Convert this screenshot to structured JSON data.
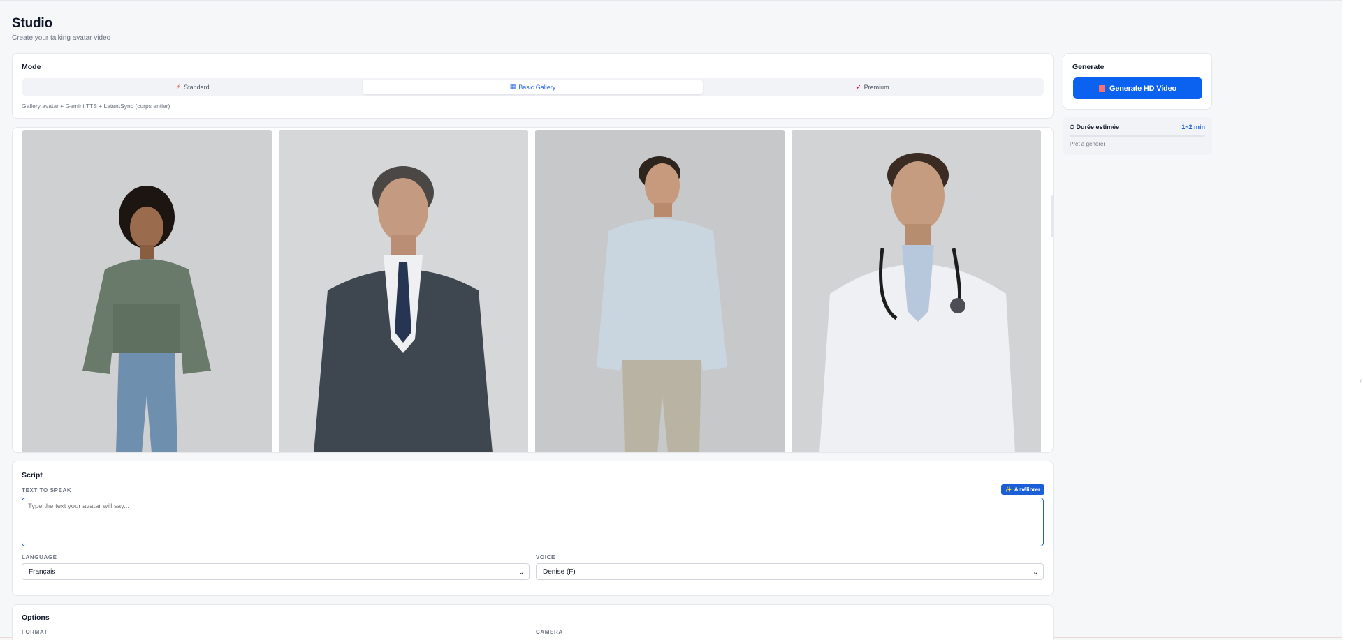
{
  "header": {
    "title": "Studio",
    "subtitle": "Create your talking avatar video"
  },
  "mode": {
    "title": "Mode",
    "options": [
      {
        "label": "Standard",
        "icon": "lightning-icon"
      },
      {
        "label": "Basic Gallery",
        "icon": "gallery-icon"
      },
      {
        "label": "Premium",
        "icon": "crown-icon"
      }
    ],
    "selected": "Basic Gallery",
    "description": "Gallery avatar + Gemini TTS + LatentSync (corps entier)"
  },
  "gallery": {
    "avatars": [
      {
        "name": "woman-green-hoodie"
      },
      {
        "name": "man-business-suit"
      },
      {
        "name": "man-light-shirt"
      },
      {
        "name": "man-doctor-coat"
      }
    ]
  },
  "script": {
    "title": "Script",
    "tts_label": "TEXT TO SPEAK",
    "improve_label": "Améliorer",
    "textarea_placeholder": "Type the text your avatar will say...",
    "textarea_value": "",
    "language_label": "LANGUAGE",
    "language_value": "Français",
    "voice_label": "VOICE",
    "voice_value": "Denise (F)"
  },
  "options": {
    "title": "Options",
    "format_label": "FORMAT",
    "camera_label": "CAMERA"
  },
  "generate": {
    "title": "Generate",
    "button_label": "Generate HD Video",
    "estimate_label": "Durée estimée",
    "estimate_value": "1~2 min",
    "progress": 0,
    "status": "Prêt à générer"
  },
  "colors": {
    "accent": "#0b62f0",
    "background": "#f6f7f9",
    "card": "#ffffff",
    "border": "#e5e7eb"
  }
}
